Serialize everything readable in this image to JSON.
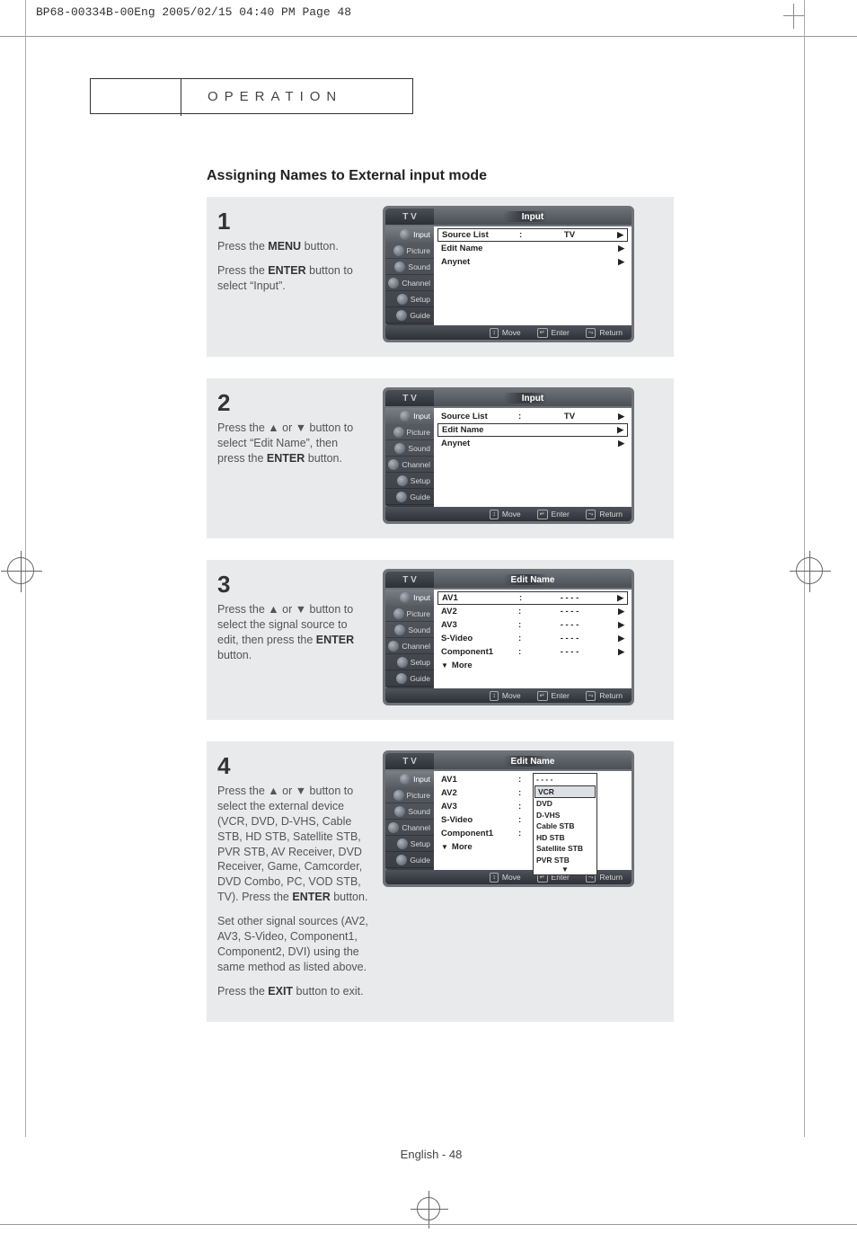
{
  "print_header": "BP68-00334B-00Eng  2005/02/15  04:40 PM  Page 48",
  "tab_label": "OPERATION",
  "section_title": "Assigning Names to External input mode",
  "steps": [
    {
      "num": "1",
      "paragraphs": [
        {
          "pre": "Press the ",
          "bold": "MENU",
          "post": " button."
        },
        {
          "pre": "Press the ",
          "bold": "ENTER",
          "post": " button to select “Input”."
        }
      ],
      "osd": {
        "tv": "T V",
        "title": "Input",
        "side": [
          "Input",
          "Picture",
          "Sound",
          "Channel",
          "Setup",
          "Guide"
        ],
        "side_active": 0,
        "rows": [
          {
            "label": "Source List",
            "colon": ":",
            "val": "TV",
            "arrow": "▶",
            "sel": true
          },
          {
            "label": "Edit Name",
            "colon": "",
            "val": "",
            "arrow": "▶",
            "sel": false
          },
          {
            "label": "Anynet",
            "colon": "",
            "val": "",
            "arrow": "▶",
            "sel": false
          }
        ],
        "foot": [
          {
            "icon": "↕",
            "label": "Move"
          },
          {
            "icon": "↵",
            "label": "Enter"
          },
          {
            "icon": "⤳",
            "label": "Return"
          }
        ]
      }
    },
    {
      "num": "2",
      "paragraphs": [
        {
          "pre": "Press the ▲ or ▼ button to select “Edit Name”, then press the ",
          "bold": "ENTER",
          "post": " button."
        }
      ],
      "osd": {
        "tv": "T V",
        "title": "Input",
        "side": [
          "Input",
          "Picture",
          "Sound",
          "Channel",
          "Setup",
          "Guide"
        ],
        "side_active": 0,
        "rows": [
          {
            "label": "Source List",
            "colon": ":",
            "val": "TV",
            "arrow": "▶",
            "sel": false
          },
          {
            "label": "Edit Name",
            "colon": "",
            "val": "",
            "arrow": "▶",
            "sel": true
          },
          {
            "label": "Anynet",
            "colon": "",
            "val": "",
            "arrow": "▶",
            "sel": false
          }
        ],
        "foot": [
          {
            "icon": "↕",
            "label": "Move"
          },
          {
            "icon": "↵",
            "label": "Enter"
          },
          {
            "icon": "⤳",
            "label": "Return"
          }
        ]
      }
    },
    {
      "num": "3",
      "paragraphs": [
        {
          "pre": "Press the ▲ or ▼ button to select the signal source to edit, then press the ",
          "bold": "ENTER",
          "post": " button."
        }
      ],
      "osd": {
        "tv": "T V",
        "title": "Edit Name",
        "side": [
          "Input",
          "Picture",
          "Sound",
          "Channel",
          "Setup",
          "Guide"
        ],
        "side_active": 0,
        "rows": [
          {
            "label": "AV1",
            "colon": ":",
            "val": "- - - -",
            "arrow": "▶",
            "sel": true
          },
          {
            "label": "AV2",
            "colon": ":",
            "val": "- - - -",
            "arrow": "▶",
            "sel": false
          },
          {
            "label": "AV3",
            "colon": ":",
            "val": "- - - -",
            "arrow": "▶",
            "sel": false
          },
          {
            "label": "S-Video",
            "colon": ":",
            "val": "- - - -",
            "arrow": "▶",
            "sel": false
          },
          {
            "label": "Component1",
            "colon": ":",
            "val": "- - - -",
            "arrow": "▶",
            "sel": false
          }
        ],
        "more": "More",
        "foot": [
          {
            "icon": "↕",
            "label": "Move"
          },
          {
            "icon": "↵",
            "label": "Enter"
          },
          {
            "icon": "⤳",
            "label": "Return"
          }
        ]
      }
    },
    {
      "num": "4",
      "paragraphs": [
        {
          "pre": "Press the ▲ or ▼ button to select the external device (VCR, DVD, D-VHS, Cable STB, HD STB, Satellite STB, PVR STB, AV Receiver, DVD Receiver, Game, Camcorder, DVD Combo, PC, VOD STB, TV). Press the ",
          "bold": "ENTER",
          "post": " button."
        },
        {
          "text": "Set other signal sources (AV2,  AV3, S-Video, Component1, Component2, DVI) using the same method as listed above."
        },
        {
          "pre": "Press the ",
          "bold": "EXIT",
          "post": " button to exit."
        }
      ],
      "osd": {
        "tv": "T V",
        "title": "Edit Name",
        "side": [
          "Input",
          "Picture",
          "Sound",
          "Channel",
          "Setup",
          "Guide"
        ],
        "side_active": 0,
        "rows_plain": [
          {
            "label": "AV1",
            "colon": ":"
          },
          {
            "label": "AV2",
            "colon": ":"
          },
          {
            "label": "AV3",
            "colon": ":"
          },
          {
            "label": "S-Video",
            "colon": ":"
          },
          {
            "label": "Component1",
            "colon": ":"
          }
        ],
        "more": "More",
        "dropdown": [
          "- - - -",
          "VCR",
          "DVD",
          "D-VHS",
          "Cable STB",
          "HD STB",
          "Satellite STB",
          "PVR STB"
        ],
        "dropdown_sel": 1,
        "foot": [
          {
            "icon": "↕",
            "label": "Move"
          },
          {
            "icon": "↵",
            "label": "Enter"
          },
          {
            "icon": "⤳",
            "label": "Return"
          }
        ]
      }
    }
  ],
  "footer": "English - 48"
}
